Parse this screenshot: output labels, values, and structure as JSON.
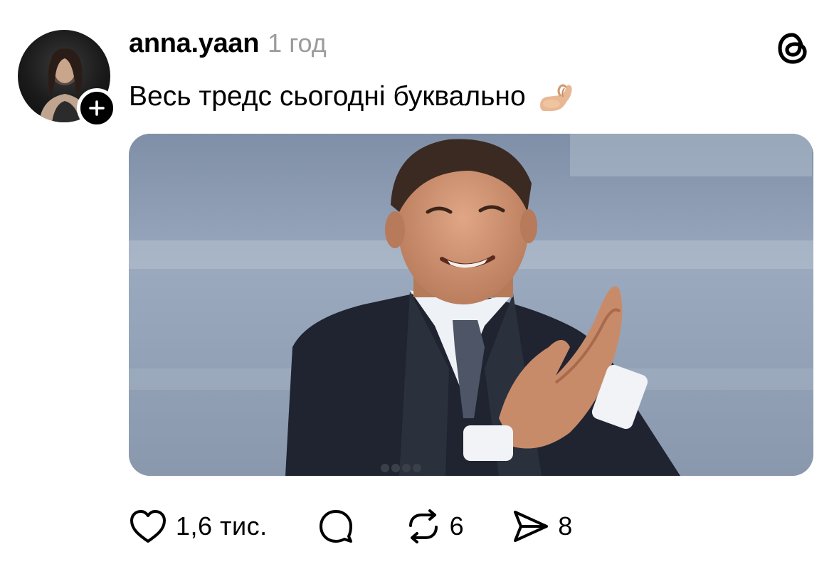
{
  "post": {
    "username": "anna.yaan",
    "time": "1 год",
    "caption": "Весь тредс сьогодні буквально",
    "caption_emoji": "pinching-hand-emoji"
  },
  "actions": {
    "likes": "1,6 тис.",
    "reposts": "6",
    "shares": "8"
  },
  "icons": {
    "like": "heart-icon",
    "reply": "comment-bubble-icon",
    "repost": "repost-icon",
    "share": "send-icon",
    "logo": "threads-logo-icon",
    "follow": "plus-icon"
  },
  "colors": {
    "text": "#000000",
    "muted": "#9b9b9b",
    "background": "#ffffff"
  }
}
